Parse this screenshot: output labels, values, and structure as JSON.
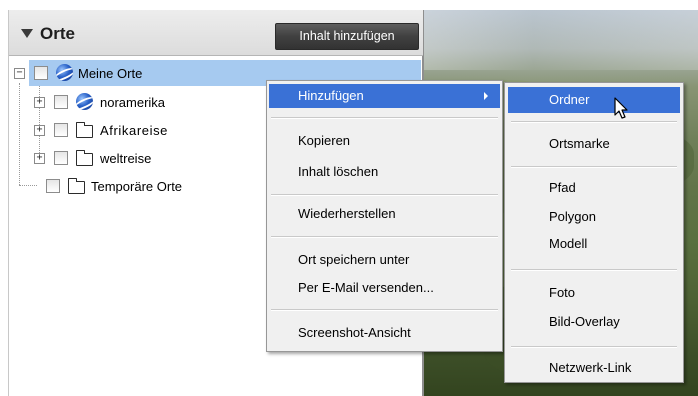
{
  "panel": {
    "title": "Orte",
    "add_button_label": "Inhalt hinzufügen"
  },
  "tree": {
    "items": [
      {
        "label": "Meine Orte",
        "icon": "globe-icon",
        "expander": "−",
        "selected": true
      },
      {
        "label": "noramerika",
        "icon": "globe-icon",
        "expander": "+"
      },
      {
        "label": "Afrikareise",
        "icon": "folder-icon",
        "expander": "+"
      },
      {
        "label": "weltreise",
        "icon": "folder-icon",
        "expander": "+"
      },
      {
        "label": "Temporäre Orte",
        "icon": "folder-icon"
      }
    ]
  },
  "context_menu": {
    "items": [
      {
        "label": "Hinzufügen",
        "highlighted": true,
        "has_submenu": true
      },
      {
        "label": "Kopieren"
      },
      {
        "label": "Inhalt löschen"
      },
      {
        "label": "Wiederherstellen"
      },
      {
        "label": "Ort speichern unter"
      },
      {
        "label": "Per E-Mail versenden..."
      },
      {
        "label": "Screenshot-Ansicht"
      }
    ]
  },
  "submenu": {
    "items": [
      {
        "label": "Ordner",
        "highlighted": true
      },
      {
        "label": "Ortsmarke"
      },
      {
        "label": "Pfad"
      },
      {
        "label": "Polygon"
      },
      {
        "label": "Modell"
      },
      {
        "label": "Foto"
      },
      {
        "label": "Bild-Overlay"
      },
      {
        "label": "Netzwerk-Link"
      }
    ]
  },
  "colors": {
    "selection": "#a6caf0",
    "menu_highlight": "#3a71d6",
    "menu_background": "#f0f0f0",
    "button_dark": "#404040"
  }
}
